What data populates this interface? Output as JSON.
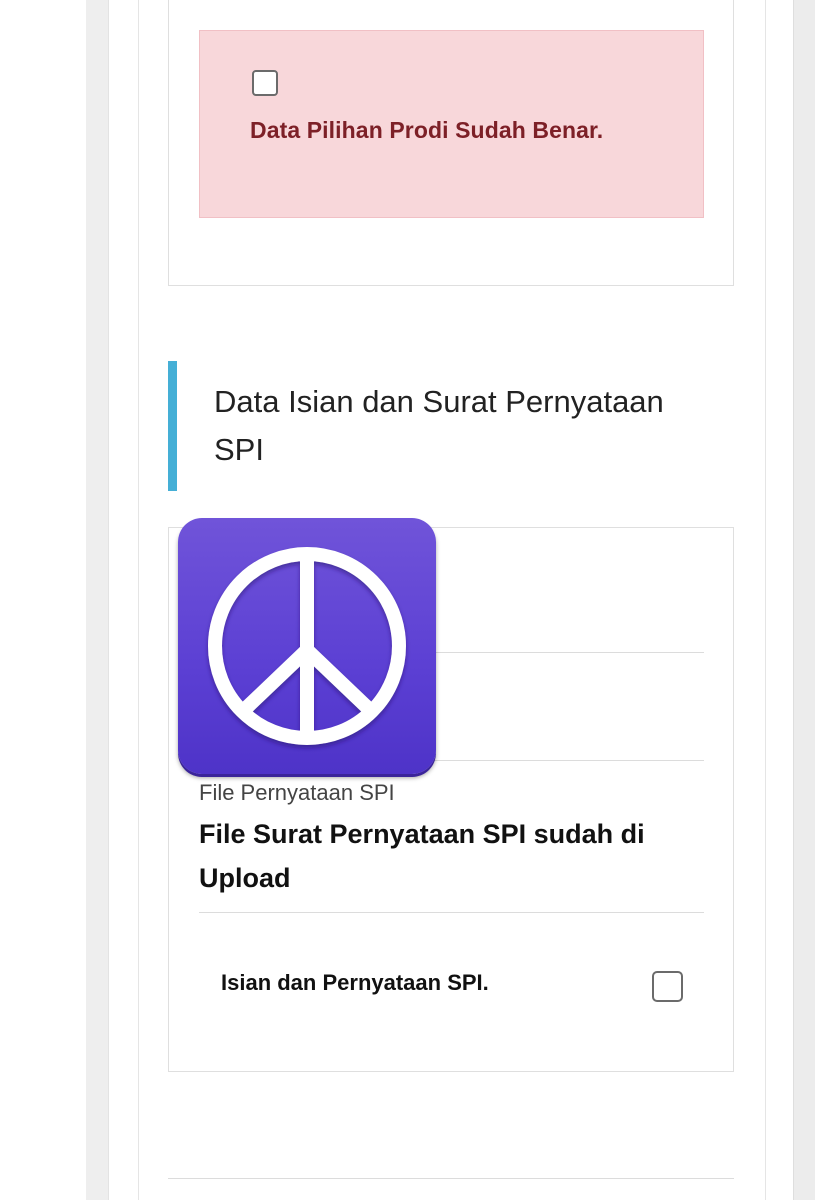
{
  "pilihan_prodi": {
    "confirmation_label": "Data Pilihan Prodi Sudah Benar.",
    "confirmation_checked": false
  },
  "spi_section": {
    "title": "Data Isian dan Surat Pernyataan SPI",
    "file_label": "File Pernyataan SPI",
    "file_status": "File Surat Pernyataan SPI sudah di Upload",
    "agreement_label": "Isian dan Pernyataan SPI.",
    "agreement_checked": false
  },
  "overlay": {
    "icon": "peace-icon",
    "colors": {
      "background": "#5b3fd3",
      "symbol": "#ffffff"
    }
  },
  "colors": {
    "alert_background": "#f8d7da",
    "alert_text": "#7d2027",
    "section_accent": "#45afd6"
  }
}
